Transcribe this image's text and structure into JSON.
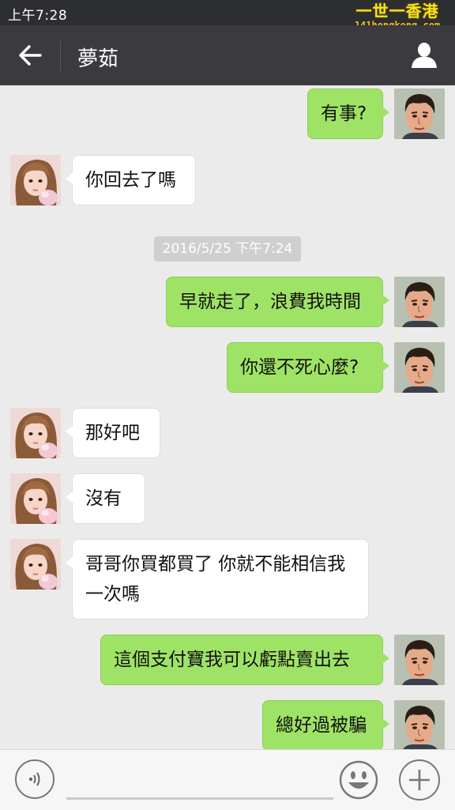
{
  "status_bar": {
    "time": "上午7:28"
  },
  "watermark": {
    "top": "一世一香港",
    "bottom": "141hongkong.com"
  },
  "header": {
    "title": "夢茹",
    "back_icon": "arrow-left-icon",
    "profile_icon": "person-icon"
  },
  "chat": {
    "messages": [
      {
        "from": "me",
        "text": "有事?"
      },
      {
        "from": "her",
        "text": "你回去了嗎"
      },
      {
        "timestamp": "2016/5/25 下午7:24"
      },
      {
        "from": "me",
        "text": "早就走了，浪費我時間"
      },
      {
        "from": "me",
        "text": "你還不死心麼?"
      },
      {
        "from": "her",
        "text": "那好吧"
      },
      {
        "from": "her",
        "text": "沒有"
      },
      {
        "from": "her",
        "text": "哥哥你買都買了 你就不能相信我一次嗎"
      },
      {
        "from": "me",
        "text": "這個支付寶我可以虧點賣出去"
      },
      {
        "from": "me",
        "text": "總好過被騙"
      }
    ]
  },
  "input_bar": {
    "voice_icon": "voice-icon",
    "emoji_icon": "smiley-icon",
    "plus_icon": "plus-icon",
    "text_value": ""
  },
  "colors": {
    "sent_bubble": "#9fe366",
    "received_bubble": "#ffffff",
    "header_bg": "#3a3a3f",
    "chat_bg": "#ebebeb"
  }
}
